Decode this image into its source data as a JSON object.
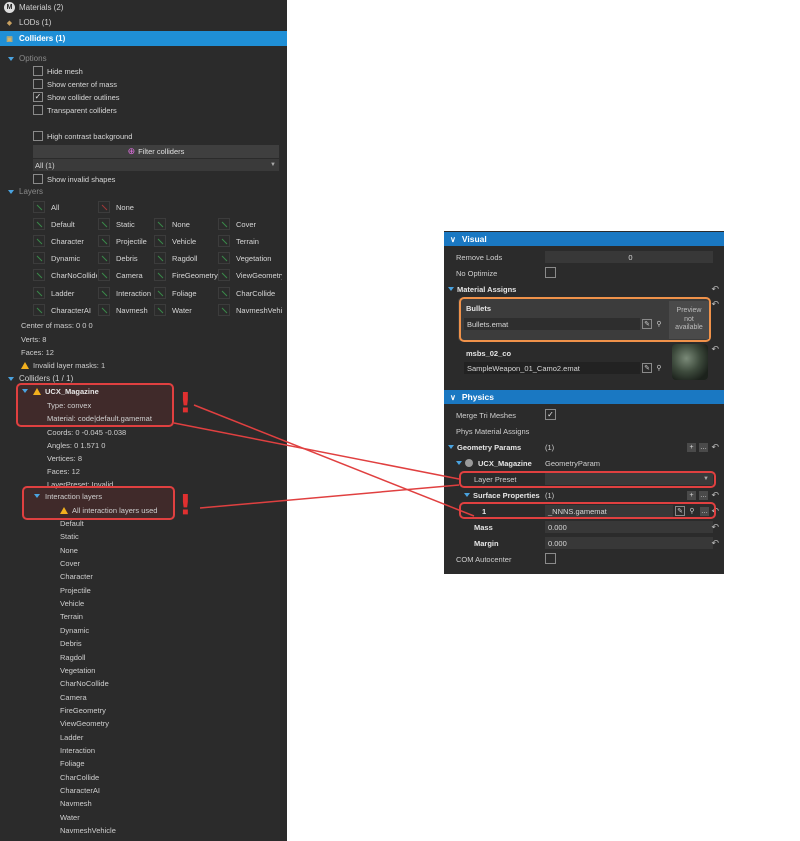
{
  "left": {
    "headers": [
      {
        "label": "Materials (2)",
        "icon": "material-m-icon"
      },
      {
        "label": "LODs (1)",
        "icon": "lod-icon"
      },
      {
        "label": "Colliders (1)",
        "icon": "collider-icon"
      }
    ],
    "options_title": "Options",
    "options": [
      {
        "label": "Hide mesh",
        "checked": false
      },
      {
        "label": "Show center of mass",
        "checked": false
      },
      {
        "label": "Show collider outlines",
        "checked": true
      },
      {
        "label": "Transparent colliders",
        "checked": false
      },
      {
        "label": "High contrast background",
        "checked": false
      }
    ],
    "filter_button": "Filter colliders",
    "filter_select": "All (1)",
    "show_invalid": "Show invalid shapes",
    "layers_title": "Layers",
    "layers": [
      [
        "All",
        "None",
        "",
        ""
      ],
      [
        "Default",
        "Static",
        "None",
        "Cover"
      ],
      [
        "Character",
        "Projectile",
        "Vehicle",
        "Terrain"
      ],
      [
        "Dynamic",
        "Debris",
        "Ragdoll",
        "Vegetation"
      ],
      [
        "CharNoCollide",
        "Camera",
        "FireGeometry",
        "ViewGeometry"
      ],
      [
        "Ladder",
        "Interaction",
        "Foliage",
        "CharCollide"
      ],
      [
        "CharacterAI",
        "Navmesh",
        "Water",
        "NavmeshVehicle"
      ]
    ],
    "center_of_mass": "Center of mass: 0 0 0",
    "verts": "Verts: 8",
    "faces": "Faces: 12",
    "invalid_masks": "Invalid layer masks: 1",
    "colliders_title": "Colliders (1 / 1)",
    "collider": {
      "name": "UCX_Magazine",
      "type": "Type: convex",
      "material": "Material: code|default.gamemat",
      "coords": "Coords: 0 -0.045 -0.038",
      "angles": "Angles: 0 1.571 0",
      "vertices": "Vertices: 8",
      "faces": "Faces: 12",
      "layer_preset": "LayerPreset: Invalid",
      "interaction_title": "Interaction layers",
      "interaction_warning": "All interaction layers used",
      "interaction_list": [
        "Default",
        "Static",
        "None",
        "Cover",
        "Character",
        "Projectile",
        "Vehicle",
        "Terrain",
        "Dynamic",
        "Debris",
        "Ragdoll",
        "Vegetation",
        "CharNoCollide",
        "Camera",
        "FireGeometry",
        "ViewGeometry",
        "Ladder",
        "Interaction",
        "Foliage",
        "CharCollide",
        "CharacterAI",
        "Navmesh",
        "Water",
        "NavmeshVehicle"
      ]
    }
  },
  "right": {
    "visual_title": "Visual",
    "remove_lods_label": "Remove Lods",
    "remove_lods_value": "0",
    "no_optimize_label": "No Optimize",
    "material_assigns_label": "Material Assigns",
    "materials": [
      {
        "name": "Bullets",
        "file": "Bullets.emat",
        "preview": "Preview not available"
      },
      {
        "name": "msbs_02_co",
        "file": "SampleWeapon_01_Camo2.emat",
        "preview": ""
      }
    ],
    "physics_title": "Physics",
    "merge_label": "Merge Tri Meshes",
    "merge_checked": true,
    "phys_mat_label": "Phys Material Assigns",
    "geometry_params_label": "Geometry Params",
    "geometry_params_value": "(1)",
    "collider_name": "UCX_Magazine",
    "collider_type": "GeometryParam",
    "layer_preset_label": "Layer Preset",
    "surface_props_label": "Surface Properties",
    "surface_props_value": "(1)",
    "surface_index": "1",
    "surface_value": "_NNNS.gamemat",
    "mass_label": "Mass",
    "mass_value": "0.000",
    "margin_label": "Margin",
    "margin_value": "0.000",
    "com_label": "COM Autocenter"
  },
  "colors": {
    "accent": "#1f8fd6",
    "highlight_red": "#e04040",
    "highlight_orange": "#f0924a",
    "warning": "#f2b01e"
  }
}
